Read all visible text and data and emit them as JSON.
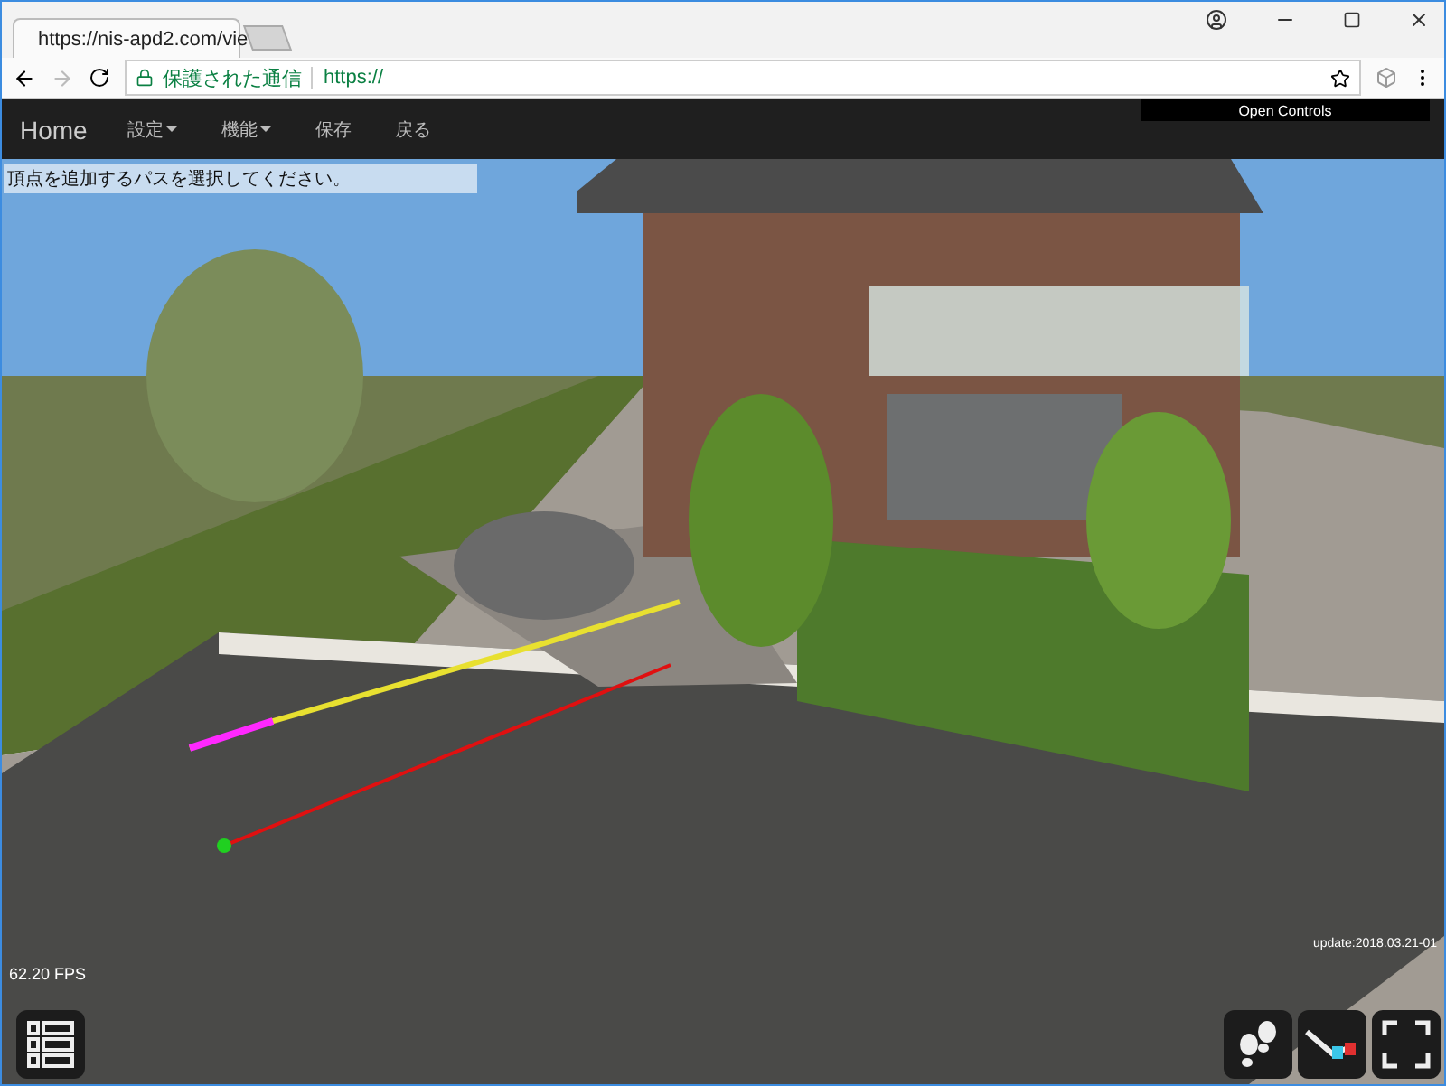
{
  "browser": {
    "tab": {
      "title": "https://nis-apd2.com/vie",
      "selected": true
    },
    "address": {
      "security": "保護された通信",
      "url": "https://"
    }
  },
  "navbar": {
    "brand": "Home",
    "items": [
      {
        "label": "設定",
        "dropdown": true
      },
      {
        "label": "機能",
        "dropdown": true
      },
      {
        "label": "保存",
        "dropdown": false
      },
      {
        "label": "戻る",
        "dropdown": false
      }
    ],
    "controls_button": "Open Controls"
  },
  "viewport": {
    "message": "頂点を追加するパスを選択してください。",
    "fps": "62.20 FPS",
    "update": "update:2018.03.21-01"
  }
}
